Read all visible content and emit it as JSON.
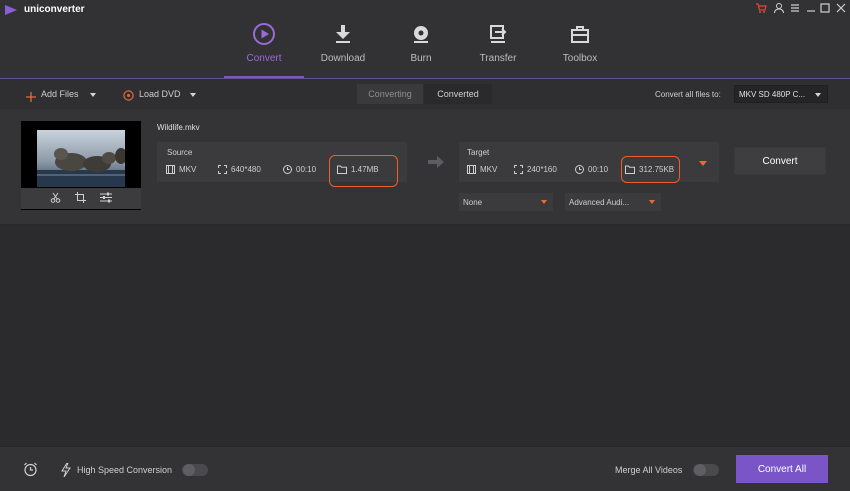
{
  "app": {
    "title": "uniconverter"
  },
  "nav": [
    {
      "label": "Convert",
      "icon": "convert-icon",
      "active": true
    },
    {
      "label": "Download",
      "icon": "download-icon"
    },
    {
      "label": "Burn",
      "icon": "burn-icon"
    },
    {
      "label": "Transfer",
      "icon": "transfer-icon"
    },
    {
      "label": "Toolbox",
      "icon": "toolbox-icon"
    }
  ],
  "toolbar": {
    "add_files": "Add Files",
    "load_dvd": "Load DVD",
    "tabs": {
      "converting": "Converting",
      "converted": "Converted"
    },
    "convert_all_to_label": "Convert all files to:",
    "format_value": "MKV SD 480P C..."
  },
  "item": {
    "file_name": "Wildlife.mkv",
    "source": {
      "title": "Source",
      "format": "MKV",
      "resolution": "640*480",
      "duration": "00:10",
      "size": "1.47MB"
    },
    "target": {
      "title": "Target",
      "format": "MKV",
      "resolution": "240*160",
      "duration": "00:10",
      "size": "312.75KB"
    },
    "subtitle_select": "None",
    "audio_select": "Advanced Audi...",
    "convert_button": "Convert"
  },
  "bottom": {
    "high_speed_label": "High Speed Conversion",
    "merge_label": "Merge All Videos",
    "convert_all_button": "Convert All"
  },
  "colors": {
    "accent": "#7a55c7",
    "highlight": "#ee5e2c",
    "active_nav": "#9b6ad8"
  }
}
